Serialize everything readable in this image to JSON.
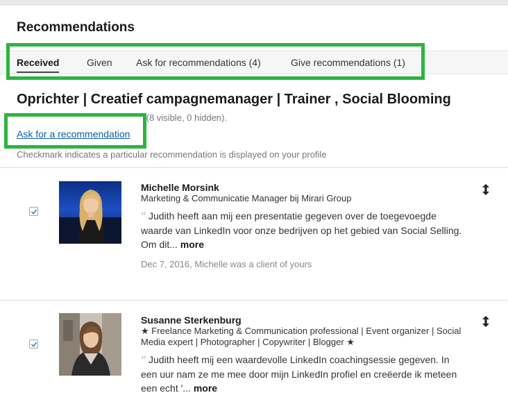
{
  "page": {
    "title": "Recommendations"
  },
  "tabs": [
    {
      "label": "Received",
      "active": true
    },
    {
      "label": "Given",
      "active": false
    },
    {
      "label": "Ask for recommendations (4)",
      "active": false
    },
    {
      "label": "Give recommendations (1)",
      "active": false
    }
  ],
  "position": {
    "headline": "Oprichter | Creatief campagnemanager | Trainer , Social Blooming",
    "summary_visible_text": "(8 visible, 0 hidden).",
    "ask_link": "Ask for a recommendation",
    "checkmark_note": "Checkmark indicates a particular recommendation is displayed on your profile"
  },
  "recommendations": [
    {
      "name": "Michelle Morsink",
      "role": "Marketing & Communicatie Manager bij Mirari Group",
      "quote": "Judith heeft aan mij een presentatie gegeven over de toegevoegde waarde van LinkedIn voor onze bedrijven op het gebied van Social Selling. Om dit...",
      "more_label": "more",
      "date_text": "Dec 7, 2016, Michelle was a client of yours",
      "checked": true,
      "drag_icon": "up-down-arrow-icon"
    },
    {
      "name": "Susanne Sterkenburg",
      "role": "★ Freelance Marketing & Communication professional | Event organizer | Social Media expert | Photographer | Copywriter | Blogger ★",
      "quote": "Judith heeft mij een waardevolle LinkedIn coachingsessie gegeven. In een uur nam ze me mee door mijn LinkedIn profiel en creëerde ik meteen een echt '...",
      "more_label": "more",
      "checked": true,
      "drag_icon": "up-down-arrow-icon"
    }
  ],
  "colors": {
    "highlight": "#2bb53f",
    "link": "#0b5ea8"
  }
}
